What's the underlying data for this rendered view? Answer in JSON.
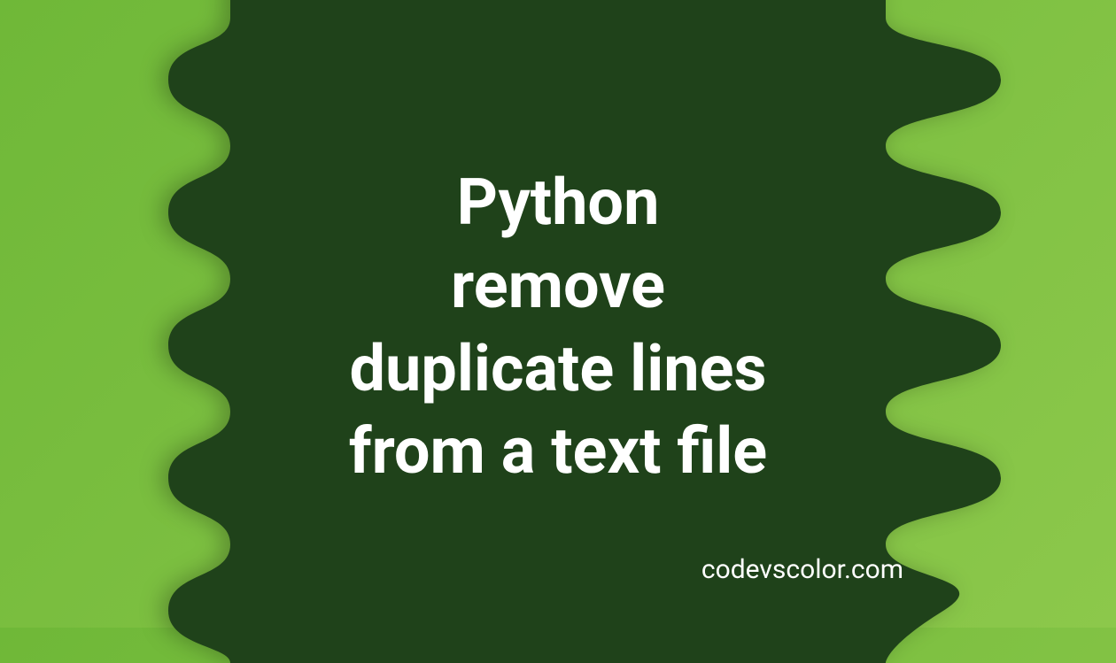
{
  "title_lines": [
    "Python",
    "remove",
    "duplicate lines",
    "from a text file"
  ],
  "brand": "codevscolor.com",
  "colors": {
    "background_start": "#6fb838",
    "background_end": "#8cc84b",
    "blob": "#1f421a",
    "text": "#ffffff"
  }
}
